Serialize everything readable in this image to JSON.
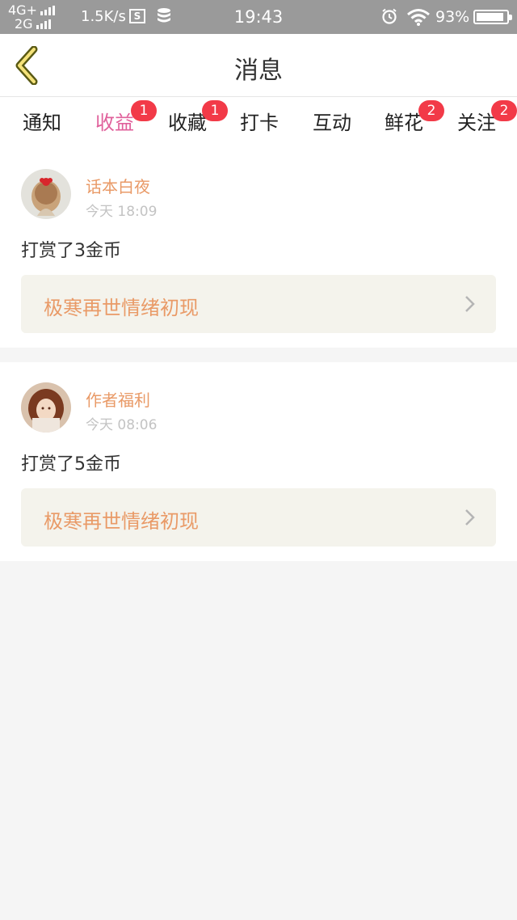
{
  "status_bar": {
    "network_top": "4G+",
    "network_bottom": "2G",
    "speed": "1.5K/s",
    "s_icon": "S",
    "time": "19:43",
    "battery_percent": "93%",
    "battery_level": 0.93
  },
  "header": {
    "title": "消息",
    "back_icon": "chevron-left-icon"
  },
  "tabs": [
    {
      "label": "通知",
      "badge": ""
    },
    {
      "label": "收益",
      "badge": "1",
      "active": true
    },
    {
      "label": "收藏",
      "badge": "1"
    },
    {
      "label": "打卡",
      "badge": ""
    },
    {
      "label": "互动",
      "badge": ""
    },
    {
      "label": "鲜花",
      "badge": "2"
    },
    {
      "label": "关注",
      "badge": "2"
    }
  ],
  "messages": [
    {
      "name": "话本白夜",
      "time": "今天 18:09",
      "text": "打赏了3金币",
      "link": "极寒再世情绪初现"
    },
    {
      "name": "作者福利",
      "time": "今天 08:06",
      "text": "打赏了5金币",
      "link": "极寒再世情绪初现"
    }
  ],
  "colors": {
    "accent": "#e0609b",
    "name_orange": "#e99a67",
    "badge_red": "#f23a48",
    "status_bar": "#9a9a9a"
  }
}
